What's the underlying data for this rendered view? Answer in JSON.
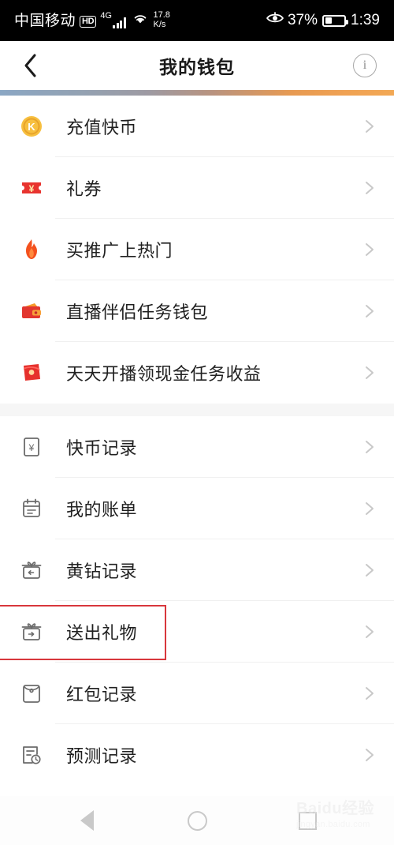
{
  "status_bar": {
    "carrier": "中国移动",
    "hd_badge": "HD",
    "network_type": "4G",
    "net_speed_value": "17.8",
    "net_speed_unit": "K/s",
    "eye_icon": "eye-care-icon",
    "battery_percent": "37%",
    "battery_level": 37,
    "clock": "1:39"
  },
  "header": {
    "back_icon": "chevron-left-icon",
    "title": "我的钱包",
    "info_icon": "info-circle-icon",
    "info_label": "i"
  },
  "accent": {
    "gradient_start": "#8ba7c4",
    "gradient_end": "#f2a855",
    "highlight_border": "#d8373c",
    "coin_gold": "#f6b83a",
    "ticket_red": "#e8342f",
    "flame_orange": "#f4511e",
    "wallet_red": "#e2362f",
    "packet_red": "#e6312c"
  },
  "sections": [
    {
      "id": "wallet-products",
      "rows": [
        {
          "id": "recharge-kuaibi",
          "label": "充值快币",
          "icon": "coin-k-icon",
          "chevron": "chevron-right-icon"
        },
        {
          "id": "gift-voucher",
          "label": "礼券",
          "icon": "ticket-yuan-icon",
          "chevron": "chevron-right-icon"
        },
        {
          "id": "buy-promotion",
          "label": "买推广上热门",
          "icon": "flame-icon",
          "chevron": "chevron-right-icon"
        },
        {
          "id": "live-companion",
          "label": "直播伴侣任务钱包",
          "icon": "wallet-icon",
          "chevron": "chevron-right-icon"
        },
        {
          "id": "daily-cash-task",
          "label": "天天开播领现金任务收益",
          "icon": "red-packet-icon",
          "chevron": "chevron-right-icon"
        }
      ]
    },
    {
      "id": "wallet-records",
      "rows": [
        {
          "id": "kuaibi-records",
          "label": "快币记录",
          "icon": "yuan-note-icon",
          "chevron": "chevron-right-icon",
          "highlighted": false
        },
        {
          "id": "my-bills",
          "label": "我的账单",
          "icon": "calendar-icon",
          "chevron": "chevron-right-icon",
          "highlighted": false
        },
        {
          "id": "diamond-records",
          "label": "黄钻记录",
          "icon": "gift-in-icon",
          "chevron": "chevron-right-icon",
          "highlighted": false
        },
        {
          "id": "gifts-sent",
          "label": "送出礼物",
          "icon": "gift-out-icon",
          "chevron": "chevron-right-icon",
          "highlighted": true
        },
        {
          "id": "red-packet-log",
          "label": "红包记录",
          "icon": "envelope-icon",
          "chevron": "chevron-right-icon",
          "highlighted": false
        },
        {
          "id": "prediction-log",
          "label": "预测记录",
          "icon": "list-clock-icon",
          "chevron": "chevron-right-icon",
          "highlighted": false
        }
      ]
    }
  ],
  "nav_bar": {
    "back_icon": "nav-back-triangle-icon",
    "home_icon": "nav-home-circle-icon",
    "recents_icon": "nav-recents-square-icon"
  },
  "watermark": {
    "main": "Baidu经验",
    "sub": "jingyan.baidu.com"
  }
}
